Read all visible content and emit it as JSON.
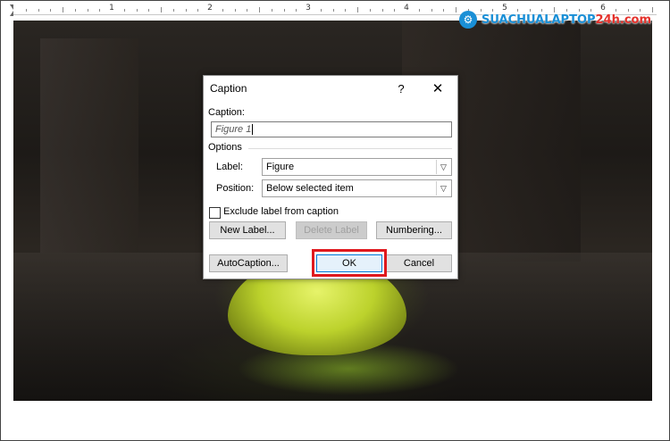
{
  "ruler": {
    "numbers": [
      "1",
      "2",
      "3",
      "4",
      "5",
      "6"
    ]
  },
  "brand": {
    "part1": "SUACHUALAPTOP",
    "part2": "24h.com"
  },
  "dialog": {
    "title": "Caption",
    "help_label": "?",
    "close_label": "✕",
    "caption_label": "Caption:",
    "caption_value": "Figure 1",
    "options_label": "Options",
    "label_label": "Label:",
    "label_value": "Figure",
    "position_label": "Position:",
    "position_value": "Below selected item",
    "exclude_label": "Exclude label from caption",
    "exclude_checked": false,
    "new_label_button": "New Label...",
    "delete_label_button": "Delete Label",
    "numbering_button": "Numbering...",
    "autocaption_button": "AutoCaption...",
    "ok_button": "OK",
    "cancel_button": "Cancel"
  },
  "colors": {
    "highlight": "#e0191e",
    "brand_blue": "#1a8fd6",
    "brand_red": "#e4312b"
  }
}
